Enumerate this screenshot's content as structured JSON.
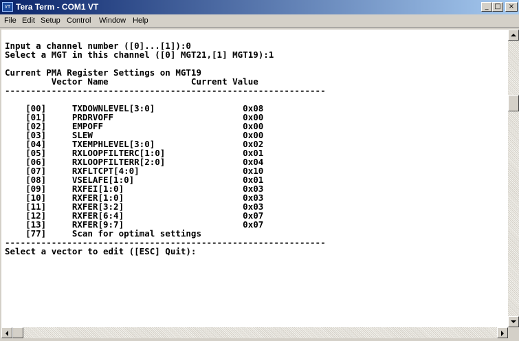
{
  "window": {
    "title": "Tera Term - COM1 VT",
    "icon_label": "VT",
    "controls": {
      "minimize": "_",
      "maximize": "□",
      "close": "×"
    }
  },
  "menu": [
    "File",
    "Edit",
    "Setup",
    "Control",
    "Window",
    "Help"
  ],
  "terminal": {
    "lines": [
      "",
      "Input a channel number ([0]...[1]):0",
      "Select a MGT in this channel ([0] MGT21,[1] MGT19):1",
      "",
      "Current PMA Register Settings on MGT19",
      "         Vector Name                Current Value",
      "--------------------------------------------------------------",
      "",
      "    [00]     TXDOWNLEVEL[3:0]                 0x08",
      "    [01]     PRDRVOFF                         0x00",
      "    [02]     EMPOFF                           0x00",
      "    [03]     SLEW                             0x00",
      "    [04]     TXEMPHLEVEL[3:0]                 0x02",
      "    [05]     RXLOOPFILTERC[1:0]               0x01",
      "    [06]     RXLOOPFILTERR[2:0]               0x04",
      "    [07]     RXFLTCPT[4:0]                    0x10",
      "    [08]     VSELAFE[1:0]                     0x01",
      "    [09]     RXFEI[1:0]                       0x03",
      "    [10]     RXFER[1:0]                       0x03",
      "    [11]     RXFER[3:2]                       0x03",
      "    [12]     RXFER[6:4]                       0x07",
      "    [13]     RXFER[9:7]                       0x07",
      "    [77]     Scan for optimal settings",
      "--------------------------------------------------------------",
      "Select a vector to edit ([ESC] Quit):"
    ]
  }
}
